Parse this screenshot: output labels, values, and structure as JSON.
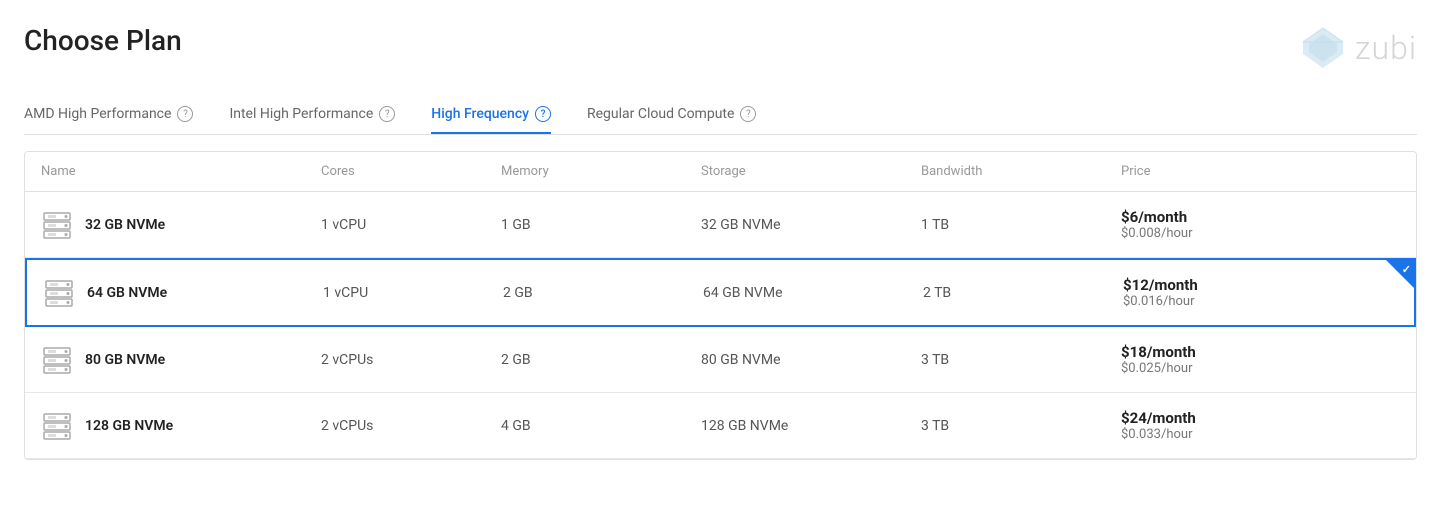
{
  "page": {
    "title": "Choose Plan"
  },
  "logo": {
    "text": "zubi"
  },
  "tabs": [
    {
      "id": "amd",
      "label": "AMD High Performance",
      "active": false
    },
    {
      "id": "intel",
      "label": "Intel High Performance",
      "active": false
    },
    {
      "id": "high-freq",
      "label": "High Frequency",
      "active": true
    },
    {
      "id": "regular",
      "label": "Regular Cloud Compute",
      "active": false
    }
  ],
  "table": {
    "columns": [
      "Name",
      "Cores",
      "Memory",
      "Storage",
      "Bandwidth",
      "Price"
    ],
    "rows": [
      {
        "id": "row-32gb",
        "name": "32 GB NVMe",
        "cores": "1 vCPU",
        "memory": "1 GB",
        "storage": "32 GB NVMe",
        "bandwidth": "1 TB",
        "price_monthly": "$6/month",
        "price_hourly": "$0.008/hour",
        "selected": false
      },
      {
        "id": "row-64gb",
        "name": "64 GB NVMe",
        "cores": "1 vCPU",
        "memory": "2 GB",
        "storage": "64 GB NVMe",
        "bandwidth": "2 TB",
        "price_monthly": "$12/month",
        "price_hourly": "$0.016/hour",
        "selected": true
      },
      {
        "id": "row-80gb",
        "name": "80 GB NVMe",
        "cores": "2 vCPUs",
        "memory": "2 GB",
        "storage": "80 GB NVMe",
        "bandwidth": "3 TB",
        "price_monthly": "$18/month",
        "price_hourly": "$0.025/hour",
        "selected": false
      },
      {
        "id": "row-128gb",
        "name": "128 GB NVMe",
        "cores": "2 vCPUs",
        "memory": "4 GB",
        "storage": "128 GB NVMe",
        "bandwidth": "3 TB",
        "price_monthly": "$24/month",
        "price_hourly": "$0.033/hour",
        "selected": false
      }
    ]
  },
  "colors": {
    "accent": "#1a73e8",
    "selected_border": "#1a73e8"
  }
}
